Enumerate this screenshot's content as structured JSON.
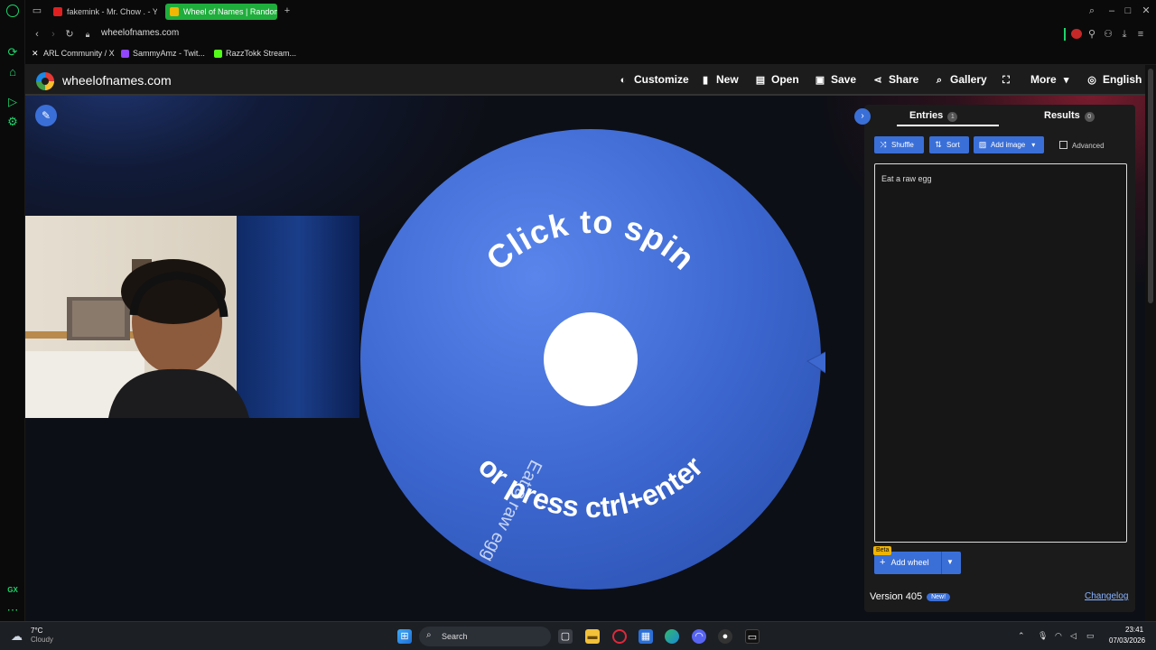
{
  "browser": {
    "tabs": [
      {
        "label": "fakemink - Mr. Chow . - Yo",
        "active": false,
        "favicon_color": "#e02020"
      },
      {
        "label": "Wheel of Names | Random",
        "active": true,
        "favicon_color": "#f2b705"
      }
    ],
    "new_tab_label": "+",
    "url": "wheelofnames.com",
    "bookmarks": [
      {
        "label": "ARL Community / X",
        "icon_color": "#ffffff"
      },
      {
        "label": "SammyAmz - Twit...",
        "icon_color": "#9146ff"
      },
      {
        "label": "RazzTokk Stream...",
        "icon_color": "#53fc18"
      }
    ],
    "sidebar_label": "GX"
  },
  "site": {
    "logo_text": "wheelofnames.com",
    "nav": [
      {
        "label": "Customize",
        "icon": "palette-icon",
        "glyph": "◐"
      },
      {
        "label": "New",
        "icon": "file-icon",
        "glyph": "▮"
      },
      {
        "label": "Open",
        "icon": "folder-icon",
        "glyph": "▤"
      },
      {
        "label": "Save",
        "icon": "floppy-icon",
        "glyph": "▣"
      },
      {
        "label": "Share",
        "icon": "share-icon",
        "glyph": "⭑"
      },
      {
        "label": "Gallery",
        "icon": "search-icon",
        "glyph": "⌕"
      },
      {
        "label": "",
        "icon": "fullscreen-icon",
        "glyph": "⛶"
      },
      {
        "label": "More",
        "icon": "chevron-down-icon",
        "glyph": "▾"
      },
      {
        "label": "English",
        "icon": "globe-icon",
        "glyph": "◎"
      }
    ],
    "wheel": {
      "top_text": "Click to spin",
      "bottom_text": "or press ctrl+enter",
      "entry_text": "Eat a raw egg",
      "color": "#3d68d0",
      "pointer_color": "#3d68d0"
    },
    "panel": {
      "tab_entries": "Entries",
      "entries_count": "1",
      "tab_results": "Results",
      "results_count": "0",
      "shuffle_label": "Shuffle",
      "sort_label": "Sort",
      "add_image_label": "Add image",
      "advanced_label": "Advanced",
      "entries_text": "Eat a raw egg",
      "beta_label": "Beta",
      "add_wheel_label": "Add wheel",
      "version_label": "Version 405",
      "new_badge": "New!",
      "changelog_label": "Changelog"
    }
  },
  "taskbar": {
    "weather_temp": "7°C",
    "weather_desc": "Cloudy",
    "search_placeholder": "Search",
    "time": "23:41",
    "date": "07/03/2026"
  }
}
